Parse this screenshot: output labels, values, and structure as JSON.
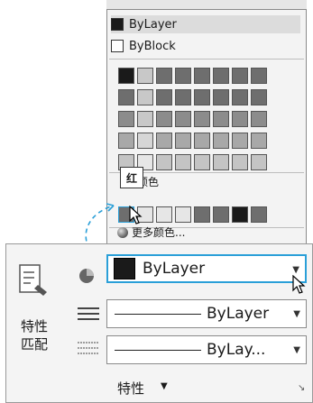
{
  "popup": {
    "options": [
      {
        "label": "ByLayer",
        "swatch": "#1a1a1a"
      },
      {
        "label": "ByBlock",
        "swatch": "#ffffff"
      }
    ],
    "index_color_rows": [
      [
        "#1a1a1a",
        "#c8c8c8",
        "#6e6e6e",
        "#6e6e6e",
        "#6e6e6e",
        "#6e6e6e",
        "#6e6e6e",
        "#6e6e6e"
      ],
      [
        "#6e6e6e",
        "#c8c8c8",
        "#6e6e6e",
        "#6e6e6e",
        "#6e6e6e",
        "#6e6e6e",
        "#6e6e6e",
        "#6e6e6e"
      ],
      [
        "#8c8c8c",
        "#c8c8c8",
        "#8c8c8c",
        "#8c8c8c",
        "#8c8c8c",
        "#8c8c8c",
        "#8c8c8c",
        "#8c8c8c"
      ],
      [
        "#a8a8a8",
        "#d6d6d6",
        "#a8a8a8",
        "#a8a8a8",
        "#a8a8a8",
        "#a8a8a8",
        "#a8a8a8",
        "#a8a8a8"
      ],
      [
        "#c4c4c4",
        "#e6e6e6",
        "#c4c4c4",
        "#c4c4c4",
        "#c4c4c4",
        "#c4c4c4",
        "#c4c4c4",
        "#c4c4c4"
      ]
    ],
    "standard_colors_label": "颜色",
    "standard_colors": [
      "#6e6e6e",
      "#e6e6e6",
      "#e6e6e6",
      "#e6e6e6",
      "#6e6e6e",
      "#6e6e6e",
      "#1a1a1a",
      "#6e6e6e"
    ],
    "tooltip": "红",
    "more_colors_label": "更多颜色..."
  },
  "panel": {
    "match_label_line1": "特性",
    "match_label_line2": "匹配",
    "color_value": "ByLayer",
    "linetype_value": "ByLayer",
    "lineweight_value": "ByLay...",
    "title": "特性",
    "title_arrow": "▼",
    "launcher": "↘"
  },
  "icons": {
    "dropdown_arrow": "▼"
  }
}
